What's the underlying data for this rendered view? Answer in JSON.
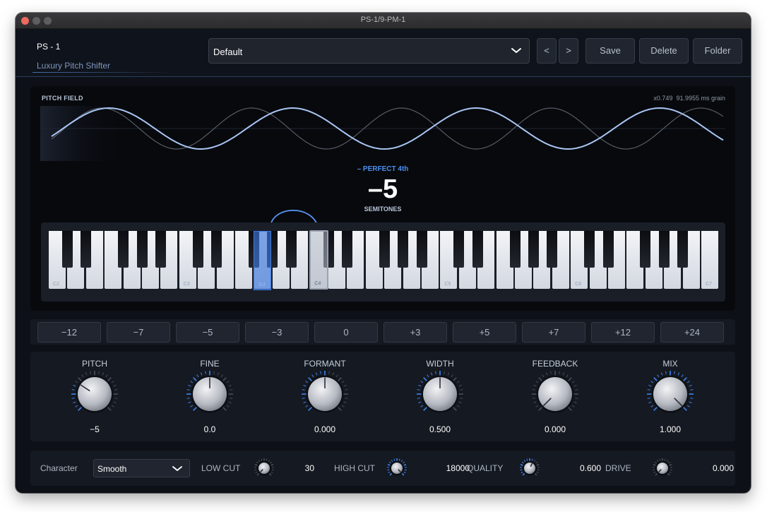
{
  "window": {
    "title": "PS-1/9-PM-1"
  },
  "header": {
    "product": "PS - 1",
    "subtitle": "Luxury Pitch Shifter",
    "preset": "Default",
    "prev": "<",
    "next": ">",
    "save": "Save",
    "delete": "Delete",
    "folder": "Folder"
  },
  "pitch_field": {
    "label": "PITCH FIELD",
    "ratio": "x0.749",
    "grain": "91.9955 ms grain",
    "interval_name": "– PERFECT 4th",
    "semitones": "–5",
    "semitones_label": "SEMITONES"
  },
  "keyboard": {
    "octave_labels": [
      "C2",
      "C3",
      "C4",
      "C5",
      "C6",
      "C7"
    ],
    "source_key_label": "C4",
    "target_key_label": "G3"
  },
  "intervals": [
    "−12",
    "−7",
    "−5",
    "−3",
    "0",
    "+3",
    "+5",
    "+7",
    "+12",
    "+24"
  ],
  "knobs": [
    {
      "name": "PITCH",
      "value": "−5",
      "level": 0.29
    },
    {
      "name": "FINE",
      "value": "0.0",
      "level": 0.5
    },
    {
      "name": "FORMANT",
      "value": "0.000",
      "level": 0.5
    },
    {
      "name": "WIDTH",
      "value": "0.500",
      "level": 0.5
    },
    {
      "name": "FEEDBACK",
      "value": "0.000",
      "level": 0.0
    },
    {
      "name": "MIX",
      "value": "1.000",
      "level": 1.0
    }
  ],
  "bottom": {
    "character_label": "Character",
    "character_value": "Smooth",
    "low_cut_label": "LOW CUT",
    "low_cut_value": "30",
    "high_cut_label": "HIGH CUT",
    "high_cut_value": "18000",
    "quality_label": "QUALITY",
    "quality_value": "0.600",
    "drive_label": "DRIVE",
    "drive_value": "0.000"
  },
  "colors": {
    "accent": "#4e8ff0",
    "background": "#0d1017",
    "panel": "#151921"
  }
}
